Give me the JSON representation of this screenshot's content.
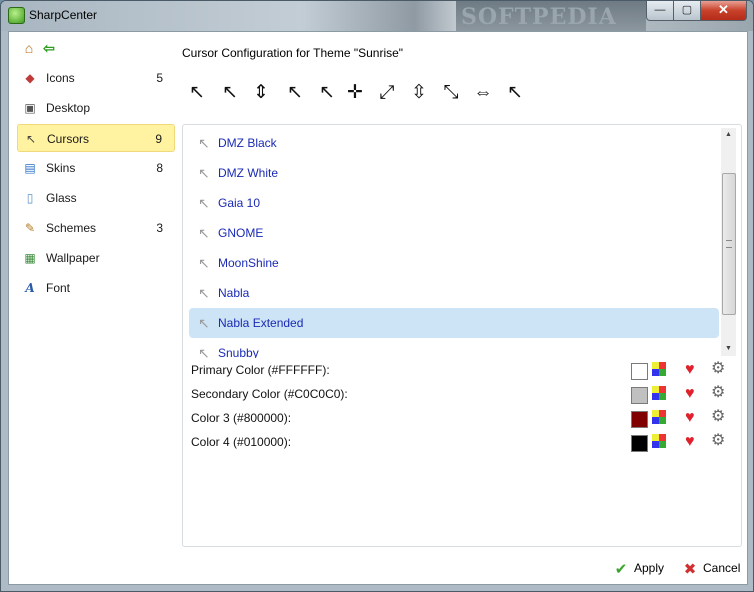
{
  "window": {
    "title": "SharpCenter",
    "watermark": "SOFTPEDIA",
    "minimize": "—",
    "maximize": "▢",
    "close": "✕"
  },
  "icons": {
    "home": "home-icon",
    "back": "back-arrow-icon"
  },
  "sidebar": {
    "items": [
      {
        "label": "Icons",
        "count": "5",
        "icon": "icons-icon"
      },
      {
        "label": "Desktop",
        "count": "",
        "icon": "desktop-icon"
      },
      {
        "label": "Cursors",
        "count": "9",
        "icon": "cursor-icon",
        "selected": true
      },
      {
        "label": "Skins",
        "count": "8",
        "icon": "skins-icon"
      },
      {
        "label": "Glass",
        "count": "",
        "icon": "glass-icon"
      },
      {
        "label": "Schemes",
        "count": "3",
        "icon": "brush-icon"
      },
      {
        "label": "Wallpaper",
        "count": "",
        "icon": "wallpaper-icon"
      },
      {
        "label": "Font",
        "count": "",
        "icon": "font-icon"
      }
    ]
  },
  "main": {
    "heading": "Cursor Configuration for Theme \"Sunrise\"",
    "cursor_list": [
      "DMZ Black",
      "DMZ White",
      "Gaia 10",
      "GNOME",
      "MoonShine",
      "Nabla",
      "Nabla Extended",
      "Snubby"
    ],
    "selected_index": 6,
    "colors": [
      {
        "label": "Primary Color (#FFFFFF):",
        "hex": "#FFFFFF"
      },
      {
        "label": "Secondary Color (#C0C0C0):",
        "hex": "#C0C0C0"
      },
      {
        "label": "Color 3 (#800000):",
        "hex": "#800000"
      },
      {
        "label": "Color 4 (#010000):",
        "hex": "#010000"
      }
    ]
  },
  "footer": {
    "apply_label": "Apply",
    "cancel_label": "Cancel"
  }
}
